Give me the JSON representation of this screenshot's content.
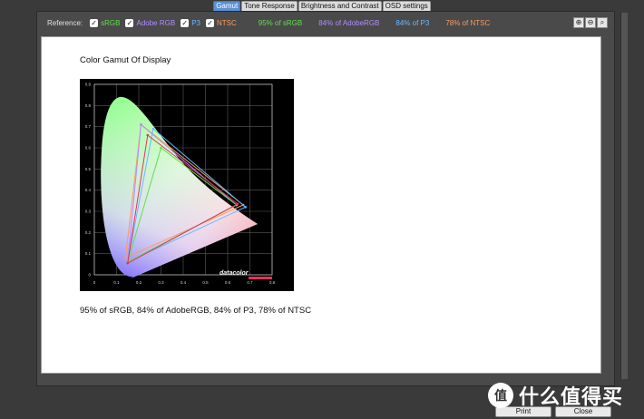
{
  "tabs": [
    {
      "label": "Gamut",
      "active": true
    },
    {
      "label": "Tone Response",
      "active": false
    },
    {
      "label": "Brightness and Contrast",
      "active": false
    },
    {
      "label": "OSD settings",
      "active": false
    }
  ],
  "reference_bar": {
    "label": "Reference:",
    "checkboxes": [
      {
        "label": "sRGB",
        "checked": true,
        "color": "#5fe04a"
      },
      {
        "label": "Adobe RGB",
        "checked": true,
        "color": "#b28bff"
      },
      {
        "label": "P3",
        "checked": true,
        "color": "#6ab7ff"
      },
      {
        "label": "NTSC",
        "checked": true,
        "color": "#ff9a5c"
      }
    ],
    "coverage": [
      {
        "text": "95% of sRGB",
        "color": "#5fe04a"
      },
      {
        "text": "84% of AdobeRGB",
        "color": "#b28bff"
      },
      {
        "text": "84% of P3",
        "color": "#6ab7ff"
      },
      {
        "text": "78% of NTSC",
        "color": "#ff9a5c"
      }
    ],
    "zoom_icons": [
      "zoom-in-icon",
      "zoom-out-icon",
      "zoom-fit-icon"
    ]
  },
  "report": {
    "title": "Color Gamut Of Display",
    "summary": "95% of sRGB, 84% of AdobeRGB, 84% of P3, 78% of NTSC",
    "plot_watermark": "datacolor"
  },
  "chart_data": {
    "type": "scatter",
    "x_ticks": [
      "0",
      "0.1",
      "0.2",
      "0.3",
      "0.4",
      "0.5",
      "0.6",
      "0.7",
      "0.8"
    ],
    "y_ticks": [
      "0",
      "0.1",
      "0.2",
      "0.3",
      "0.4",
      "0.5",
      "0.6",
      "0.7",
      "0.8",
      "0.9"
    ],
    "xlim": [
      0,
      0.8
    ],
    "ylim": [
      0,
      0.9
    ],
    "grid": true,
    "series": [
      {
        "color": "#ff9a5c",
        "points": [
          [
            0.67,
            0.33
          ],
          [
            0.21,
            0.71
          ],
          [
            0.14,
            0.08
          ]
        ]
      },
      {
        "color": "#b28bff",
        "points": [
          [
            0.64,
            0.33
          ],
          [
            0.21,
            0.71
          ],
          [
            0.15,
            0.06
          ]
        ]
      },
      {
        "color": "#6ab7ff",
        "points": [
          [
            0.68,
            0.32
          ],
          [
            0.265,
            0.69
          ],
          [
            0.15,
            0.06
          ]
        ]
      },
      {
        "color": "#5fe04a",
        "points": [
          [
            0.64,
            0.33
          ],
          [
            0.3,
            0.6
          ],
          [
            0.15,
            0.06
          ]
        ]
      },
      {
        "color": "#e0345a",
        "points": [
          [
            0.645,
            0.335
          ],
          [
            0.24,
            0.66
          ],
          [
            0.15,
            0.055
          ]
        ]
      }
    ]
  },
  "buttons": {
    "print": "Print",
    "close": "Close"
  },
  "watermark": {
    "text": "什么值得买"
  }
}
